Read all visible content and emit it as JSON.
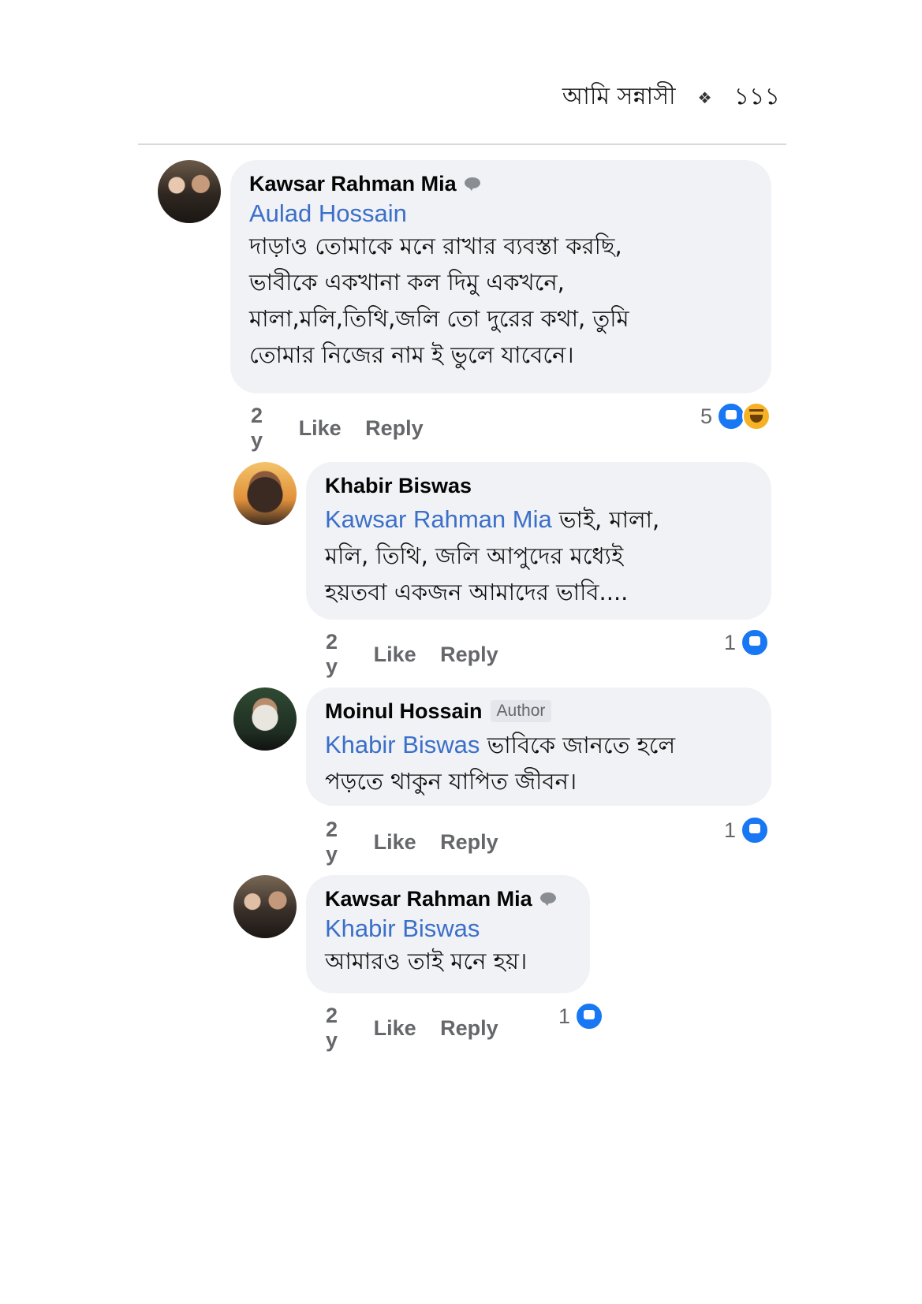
{
  "header": {
    "title": "আমি সন্নাসী",
    "ornament": "❖",
    "page_number": "১১১"
  },
  "comments": [
    {
      "author": "Kawsar Rahman Mia",
      "mention": "Aulad Hossain",
      "lines": [
        "দাড়াও তোমাকে মনে রাখার ব্যবস্তা করছি,",
        "ভাবীকে একখানা কল দিমু একখনে,",
        "মালা,মলি,তিথি,জলি তো দুরের কথা, তুমি",
        "তোমার নিজের নাম ই ভুলে যাবেনে।"
      ],
      "time": "2 y",
      "like_label": "Like",
      "reply_label": "Reply",
      "reaction_count": "5"
    },
    {
      "author": "Khabir Biswas",
      "mention": "Kawsar Rahman Mia",
      "lines": [
        " ভাই, মালা,",
        "মলি, তিথি, জলি আপুদের মধ্যেই",
        "হয়তবা একজন আমাদের ভাবি...."
      ],
      "time": "2 y",
      "like_label": "Like",
      "reply_label": "Reply",
      "reaction_count": "1"
    },
    {
      "author": "Moinul Hossain",
      "author_tag": "Author",
      "mention": "Khabir Biswas",
      "lines": [
        " ভাবিকে জানতে হলে",
        "পড়তে থাকুন যাপিত জীবন।"
      ],
      "time": "2 y",
      "like_label": "Like",
      "reply_label": "Reply",
      "reaction_count": "1"
    },
    {
      "author": "Kawsar Rahman Mia",
      "mention": "Khabir Biswas",
      "lines": [
        "আমারও তাই মনে হয়।"
      ],
      "time": "2 y",
      "like_label": "Like",
      "reply_label": "Reply",
      "reaction_count": "1"
    }
  ],
  "colors": {
    "bubble": "#f0f2f5",
    "mention": "#3b6fc9",
    "like": "#1877f2",
    "haha": "#f7b125",
    "meta": "#65676b"
  }
}
